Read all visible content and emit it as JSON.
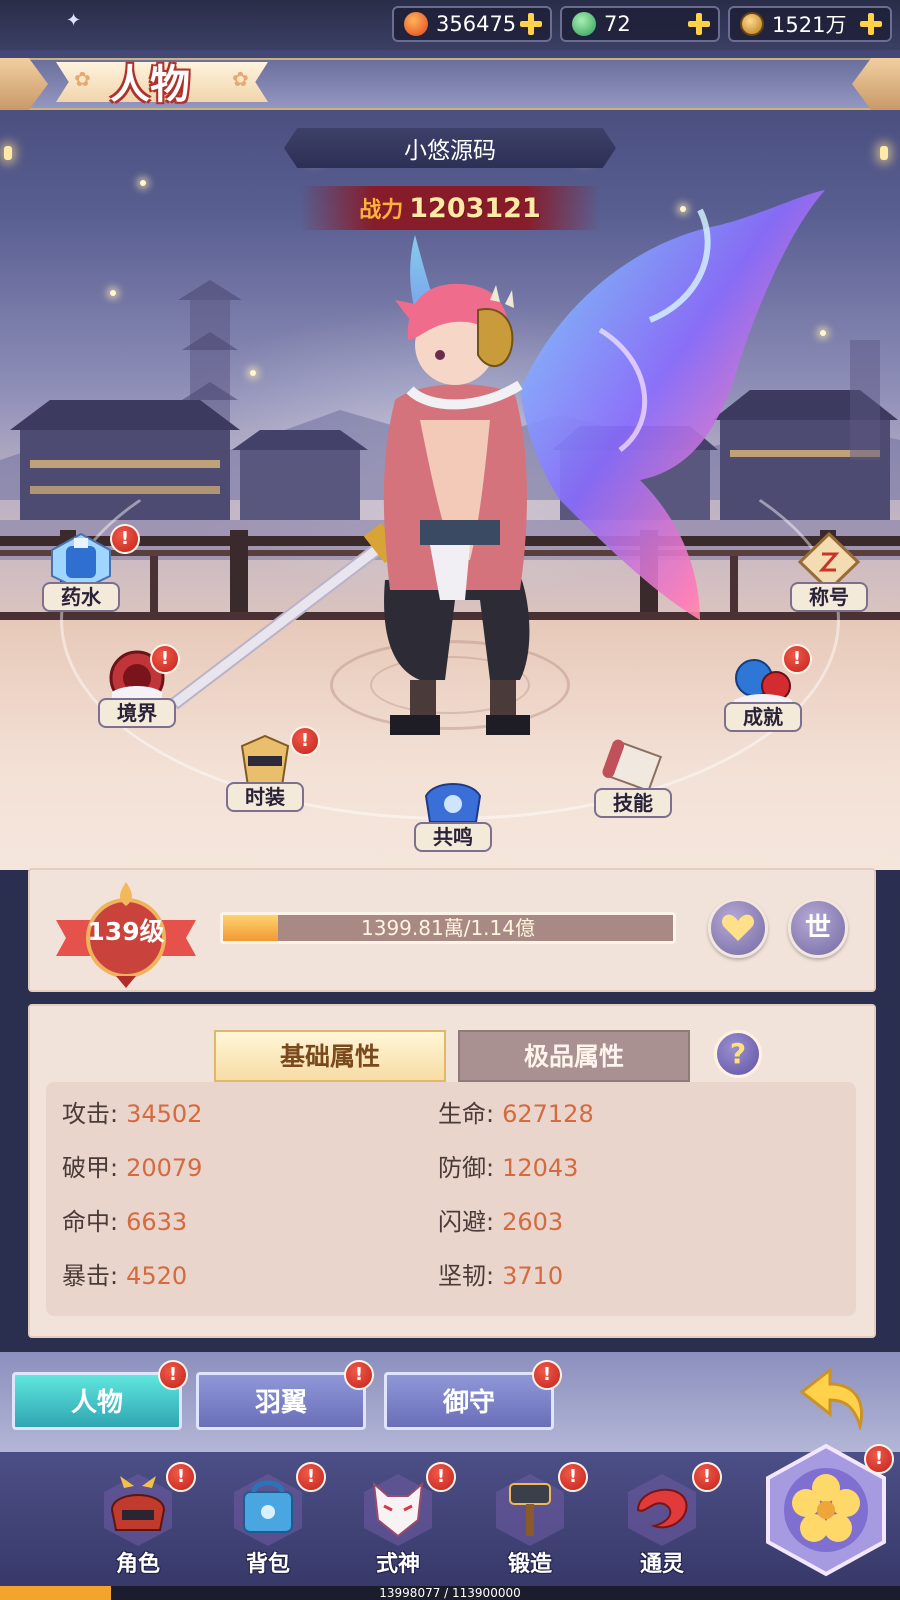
{
  "currency": [
    {
      "icon": "red-gem-icon",
      "value": "356475"
    },
    {
      "icon": "green-jade-icon",
      "value": "72"
    },
    {
      "icon": "copper-coin-icon",
      "value": "1521万"
    }
  ],
  "title": "人物",
  "character": {
    "name": "小悠源码",
    "power_label": "战力",
    "power_value": "1203121"
  },
  "orbit_menu": [
    {
      "key": "potion",
      "label": "药水",
      "badge": true,
      "icon": "potion-icon"
    },
    {
      "key": "realm",
      "label": "境界",
      "badge": true,
      "icon": "realm-icon"
    },
    {
      "key": "costume",
      "label": "时装",
      "badge": true,
      "icon": "costume-icon"
    },
    {
      "key": "resonance",
      "label": "共鸣",
      "badge": false,
      "icon": "resonance-icon"
    },
    {
      "key": "skill",
      "label": "技能",
      "badge": false,
      "icon": "scroll-icon"
    },
    {
      "key": "achievement",
      "label": "成就",
      "badge": true,
      "icon": "achievement-icon"
    },
    {
      "key": "title",
      "label": "称号",
      "badge": false,
      "icon": "title-icon"
    }
  ],
  "level": {
    "text": "139级",
    "exp_text": "1399.81萬/1.14億",
    "exp_fraction": 0.123,
    "heart_icon": "heart-icon",
    "world_button": "世"
  },
  "attributes": {
    "tab_basic": "基础属性",
    "tab_premium": "极品属性",
    "help": "?",
    "left": [
      {
        "label": "攻击:",
        "value": "34502"
      },
      {
        "label": "破甲:",
        "value": "20079"
      },
      {
        "label": "命中:",
        "value": "6633"
      },
      {
        "label": "暴击:",
        "value": "4520"
      }
    ],
    "right": [
      {
        "label": "生命:",
        "value": "627128"
      },
      {
        "label": "防御:",
        "value": "12043"
      },
      {
        "label": "闪避:",
        "value": "2603"
      },
      {
        "label": "坚韧:",
        "value": "3710"
      }
    ]
  },
  "sub_tabs": [
    {
      "label": "人物",
      "active": true
    },
    {
      "label": "羽翼",
      "active": false
    },
    {
      "label": "御守",
      "active": false
    }
  ],
  "badge_symbol": "!",
  "nav": [
    {
      "label": "角色",
      "icon": "samurai-helmet-icon"
    },
    {
      "label": "背包",
      "icon": "bag-icon"
    },
    {
      "label": "式神",
      "icon": "fox-mask-icon"
    },
    {
      "label": "锻造",
      "icon": "hammer-icon"
    },
    {
      "label": "通灵",
      "icon": "dragon-icon"
    }
  ],
  "bottom_exp": {
    "text": "13998077 / 113900000",
    "fraction": 0.123
  },
  "colors": {
    "accent_gold": "#ffd24a",
    "badge_red": "#d22a22",
    "attr_value": "#d46a3e",
    "active_tab": "#3fc1c6"
  }
}
